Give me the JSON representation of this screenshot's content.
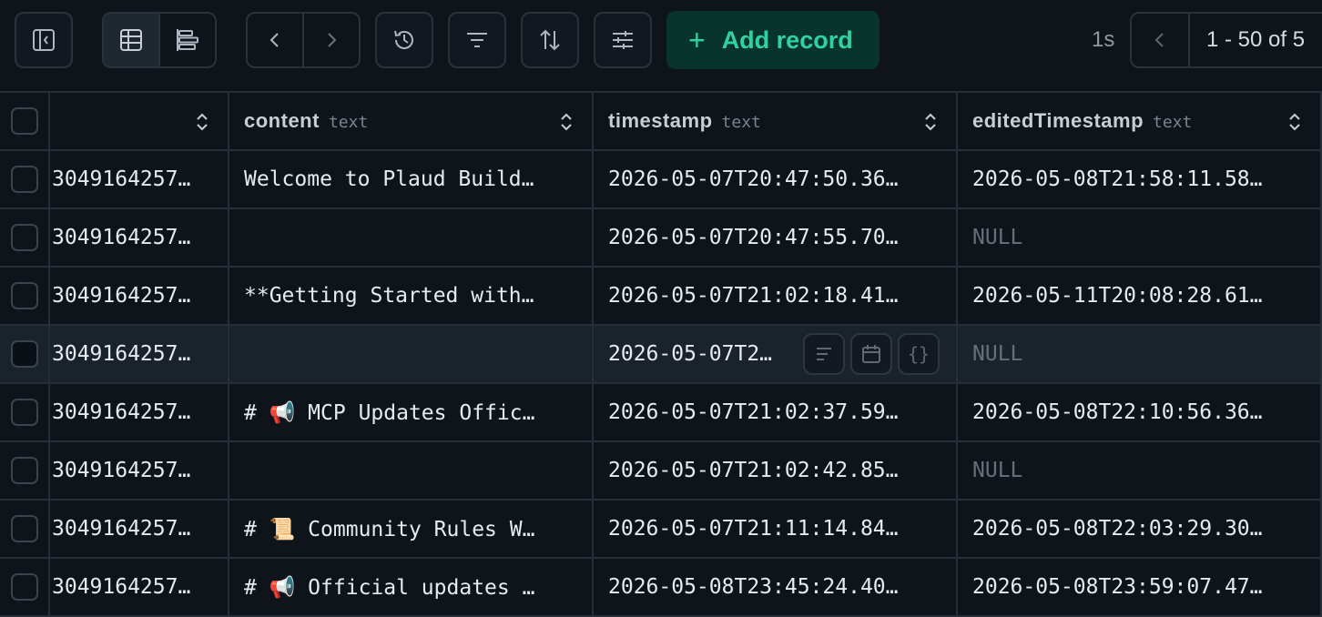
{
  "toolbar": {
    "add_label": "Add record",
    "add_icon": "plus-icon",
    "accent": "#2fd3a1",
    "query_time": "1s",
    "page_range": "1 - 50 of 5"
  },
  "table": {
    "columns": [
      {
        "name": "",
        "type": ""
      },
      {
        "name": "content",
        "type": "text"
      },
      {
        "name": "timestamp",
        "type": "text"
      },
      {
        "name": "editedTimestamp",
        "type": "text"
      }
    ],
    "rows": [
      {
        "id": "3049164257…",
        "content": "Welcome to Plaud Build…",
        "timestamp": "2026-05-07T20:47:50.36…",
        "edited": "2026-05-08T21:58:11.58…"
      },
      {
        "id": "3049164257…",
        "content": "",
        "timestamp": "2026-05-07T20:47:55.70…",
        "edited": "NULL"
      },
      {
        "id": "3049164257…",
        "content": "**Getting Started with…",
        "timestamp": "2026-05-07T21:02:18.41…",
        "edited": "2026-05-11T20:08:28.61…"
      },
      {
        "id": "3049164257…",
        "content": "",
        "timestamp": "2026-05-07T2…",
        "edited": "NULL"
      },
      {
        "id": "3049164257…",
        "content": "# 📢 MCP Updates Offic…",
        "timestamp": "2026-05-07T21:02:37.59…",
        "edited": "2026-05-08T22:10:56.36…"
      },
      {
        "id": "3049164257…",
        "content": "",
        "timestamp": "2026-05-07T21:02:42.85…",
        "edited": "NULL"
      },
      {
        "id": "3049164257…",
        "content": "# 📜 Community Rules W…",
        "timestamp": "2026-05-07T21:11:14.84…",
        "edited": "2026-05-08T22:03:29.30…"
      },
      {
        "id": "3049164257…",
        "content": "# 📢 Official updates …",
        "timestamp": "2026-05-08T23:45:24.40…",
        "edited": "2026-05-08T23:59:07.47…"
      }
    ]
  }
}
